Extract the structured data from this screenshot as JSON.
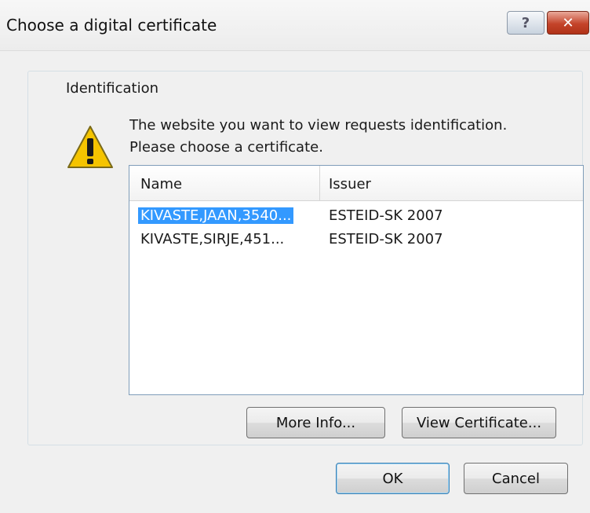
{
  "window": {
    "title": "Choose a digital certificate",
    "help_label": "?",
    "close_label": "✕"
  },
  "group": {
    "label": "Identification"
  },
  "message": {
    "line1": "The website you want to view requests identification.",
    "line2": "Please choose a certificate."
  },
  "certificates": {
    "columns": [
      "Name",
      "Issuer"
    ],
    "rows": [
      {
        "name": "KIVASTE,JAAN,3540...",
        "issuer": "ESTEID-SK 2007",
        "selected": true
      },
      {
        "name": "KIVASTE,SIRJE,451...",
        "issuer": "ESTEID-SK 2007",
        "selected": false
      }
    ]
  },
  "buttons": {
    "more_info": "More Info...",
    "view_certificate": "View Certificate...",
    "ok": "OK",
    "cancel": "Cancel"
  },
  "icons": {
    "warning": "warning-icon"
  },
  "colors": {
    "selection": "#3399ff",
    "dialog_bg": "#f0f0f0",
    "warning_fill": "#f5c400"
  }
}
